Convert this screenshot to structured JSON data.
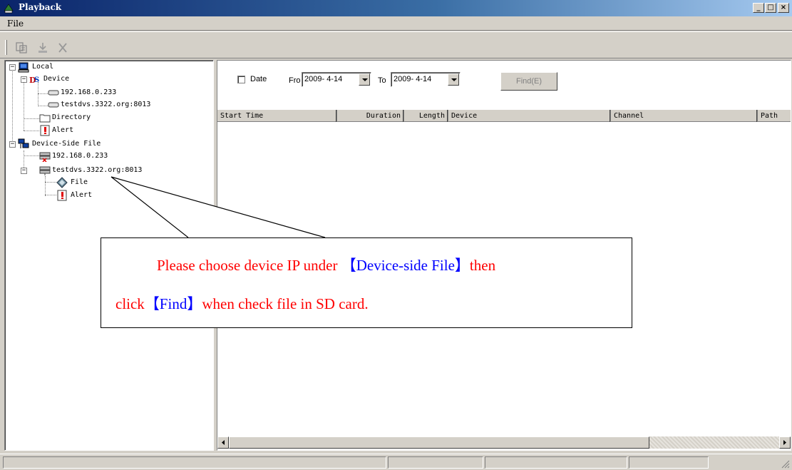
{
  "window": {
    "title": "Playback",
    "controls": [
      "_",
      "□",
      "×"
    ]
  },
  "menu": {
    "file_label": "File"
  },
  "toolbar": {
    "buttons": [
      "properties-icon",
      "download-icon",
      "delete-icon"
    ]
  },
  "tree": {
    "local": "Local",
    "device": "Device",
    "device_ip": "192.168.0.233",
    "device_host": "testdvs.3322.org:8013",
    "directory": "Directory",
    "alert": "Alert",
    "device_side_file": "Device-Side File",
    "ds_ip": "192.168.0.233",
    "ds_host": "testdvs.3322.org:8013",
    "ds_file": "File",
    "ds_alert": "Alert"
  },
  "search": {
    "date_label": "Date",
    "from_label": "Fro",
    "from_value": "2009- 4-14",
    "to_label": "To",
    "to_value": "2009- 4-14",
    "find_label": "Find(E)"
  },
  "table": {
    "columns": [
      "Start Time",
      "Duration",
      "Length",
      "Device",
      "Channel",
      "Path"
    ]
  },
  "callout": {
    "line1_a": "Please choose device IP under  ",
    "line1_b": "【Device-side File】",
    "line1_c": "then",
    "line2_a": "click",
    "line2_b": "【Find】",
    "line2_c": "when check file in SD card."
  },
  "colors": {
    "callout_red": "#ff0000",
    "callout_blue": "#0000ff",
    "titlebar": "#0a246a"
  }
}
